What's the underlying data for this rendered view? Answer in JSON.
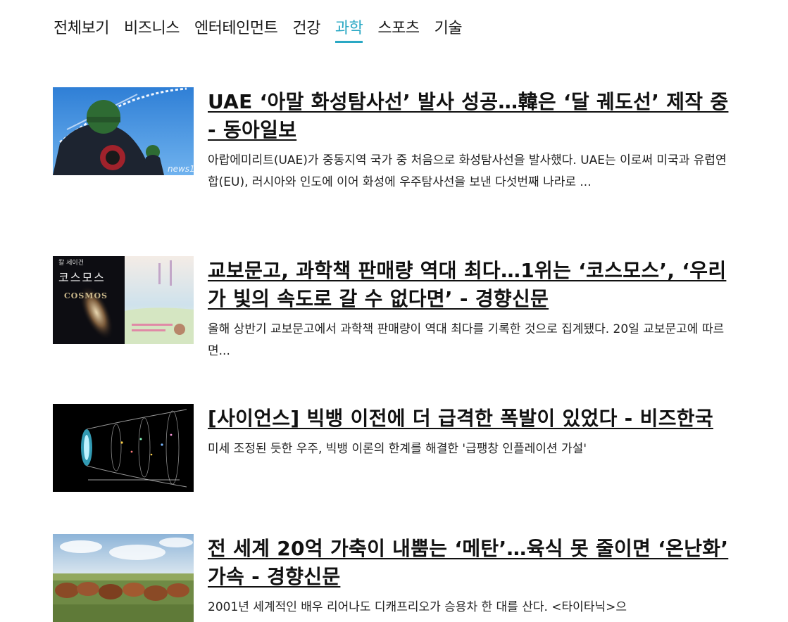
{
  "tabs": [
    {
      "label": "전체보기",
      "active": false
    },
    {
      "label": "비즈니스",
      "active": false
    },
    {
      "label": "엔터테인먼트",
      "active": false
    },
    {
      "label": "건강",
      "active": false
    },
    {
      "label": "과학",
      "active": true
    },
    {
      "label": "스포츠",
      "active": false
    },
    {
      "label": "기술",
      "active": false
    }
  ],
  "accent_color": "#2aa8c4",
  "articles": [
    {
      "title": "UAE ‘아말 화성탐사선’ 발사 성공…韓은 ‘달 궤도선’ 제작 중 - 동아일보",
      "summary": "아랍에미리트(UAE)가 중동지역 국가 중 처음으로 화성탐사선을 발사했다. UAE는 이로써 미국과 유럽연합(EU), 러시아와 인도에 이어 화성에 우주탐사선을 보낸 다섯번째 나라로 ...",
      "thumb_watermark": "news1"
    },
    {
      "title": "교보문고, 과학책 판매량 역대 최다…1위는 ‘코스모스’, ‘우리가 빛의 속도로 갈 수 없다면’ - 경향신문",
      "summary": "올해 상반기 교보문고에서 과학책 판매량이 역대 최다를 기록한 것으로 집계됐다. 20일 교보문고에 따르면...",
      "thumb_author": "칼 세이건",
      "thumb_book_kr": "코스모스",
      "thumb_book_en": "COSMOS"
    },
    {
      "title": "[사이언스] 빅뱅 이전에 더 급격한 폭발이 있었다 - 비즈한국",
      "summary": "미세 조정된 듯한 우주, 빅뱅 이론의 한계를 해결한 '급팽창 인플레이션 가설'"
    },
    {
      "title": "전 세계 20억 가축이 내뿜는 ‘메탄’…육식 못 줄이면 ‘온난화’ 가속 - 경향신문",
      "summary": "2001년 세계적인 배우 리어나도 디캐프리오가 승용차 한 대를 산다. <타이타닉>으"
    }
  ]
}
